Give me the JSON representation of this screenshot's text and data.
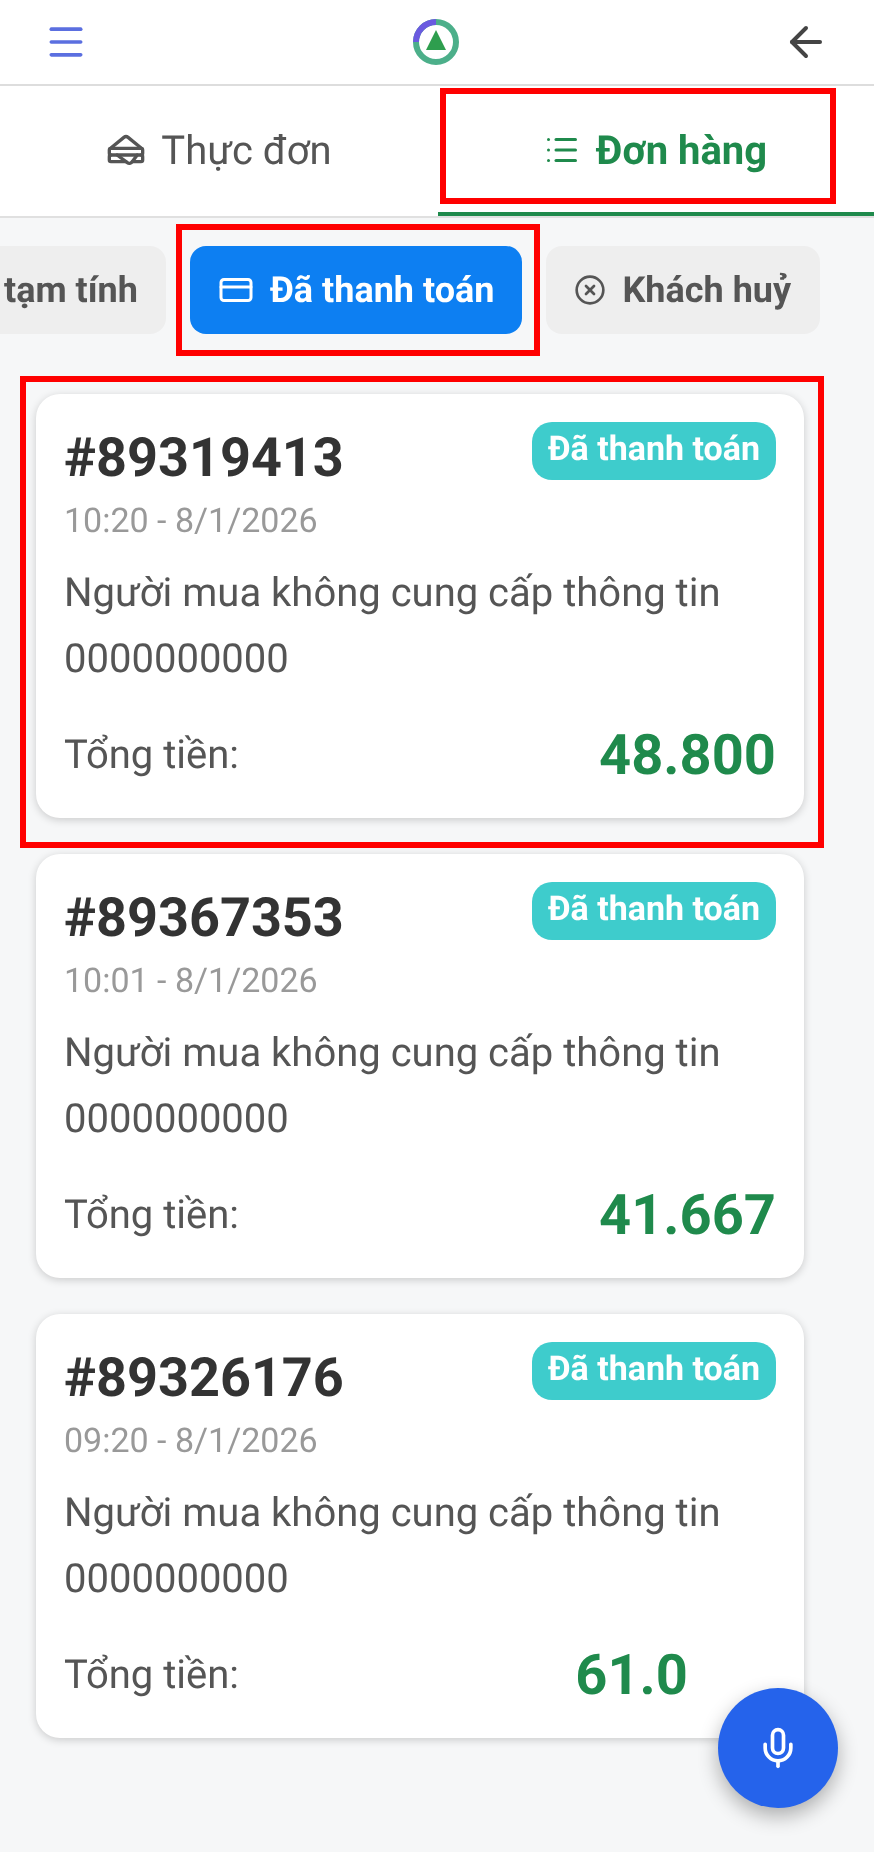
{
  "tabs": [
    {
      "label": "Thực đơn",
      "kind": "menu",
      "selected": false,
      "highlighted": false
    },
    {
      "label": "Đơn hàng",
      "kind": "orders",
      "selected": true,
      "highlighted": true
    }
  ],
  "filters": [
    {
      "label": "tạm tính",
      "kind": "none",
      "selected": false,
      "highlighted": false
    },
    {
      "label": "Đã thanh toán",
      "kind": "card",
      "selected": true,
      "highlighted": true
    },
    {
      "label": "Khách huỷ",
      "kind": "cancel",
      "selected": false,
      "highlighted": false
    }
  ],
  "orders": [
    {
      "id": "#89319413",
      "status": "Đã thanh toán",
      "time": "10:20 - 8/1/2026",
      "buyer": "Người mua không cung cấp thông tin",
      "phone": "0000000000",
      "total_label": "Tổng tiền:",
      "total": "48.800",
      "highlighted": true
    },
    {
      "id": "#89367353",
      "status": "Đã thanh toán",
      "time": "10:01 - 8/1/2026",
      "buyer": "Người mua không cung cấp thông tin",
      "phone": "0000000000",
      "total_label": "Tổng tiền:",
      "total": "41.667",
      "highlighted": false
    },
    {
      "id": "#89326176",
      "status": "Đã thanh toán",
      "time": "09:20 - 8/1/2026",
      "buyer": "Người mua không cung cấp thông tin",
      "phone": "0000000000",
      "total_label": "Tổng tiền:",
      "total": "61.0",
      "highlighted": false
    }
  ]
}
